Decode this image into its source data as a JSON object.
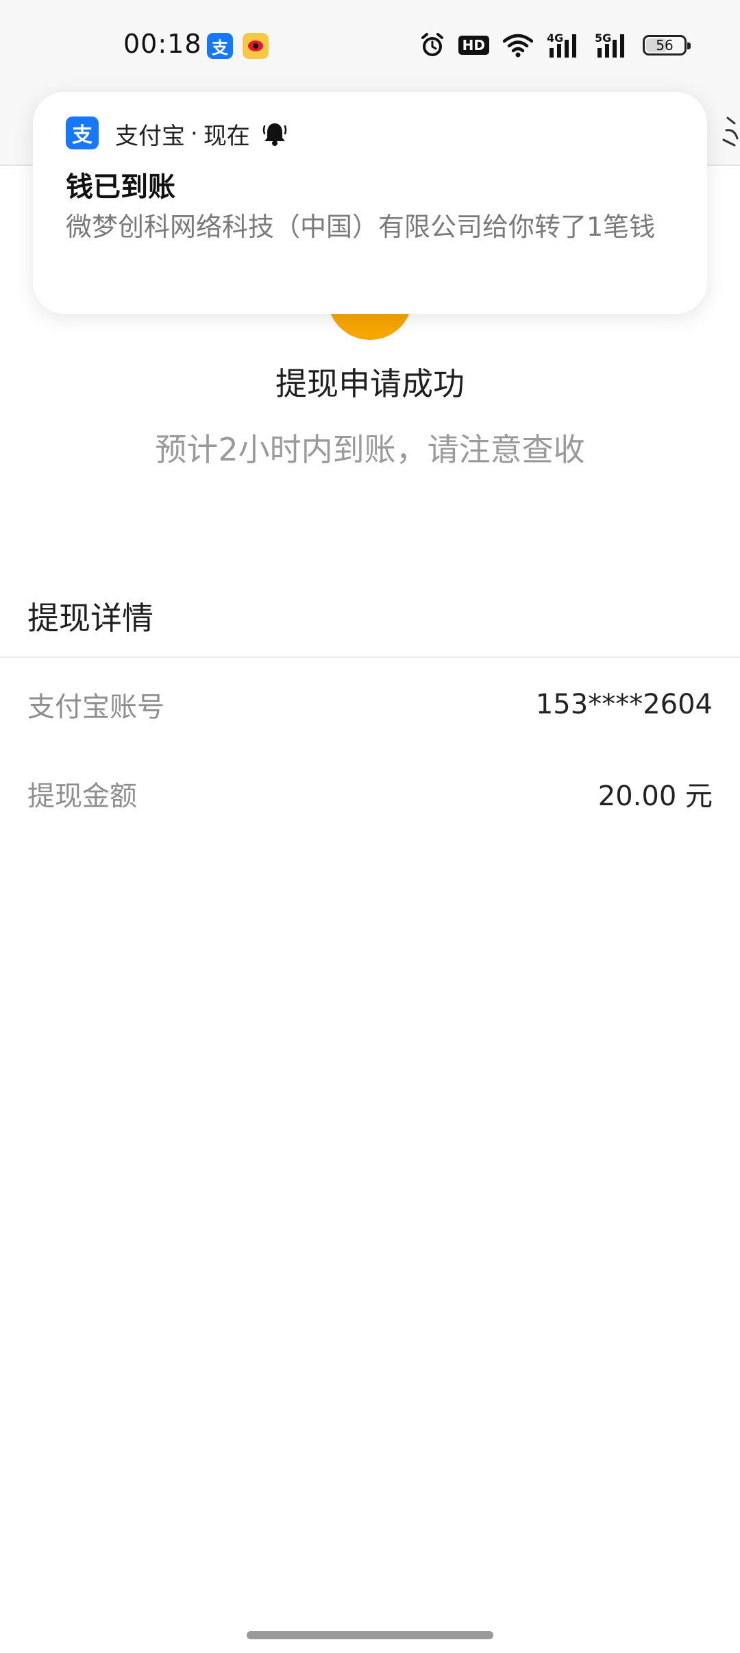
{
  "status_bar": {
    "time": "00:18",
    "battery": "56",
    "battery_level": 0.56,
    "network_4g": "4G",
    "network_5g": "5G",
    "hd_label": "HD"
  },
  "notification": {
    "app_icon_glyph": "支",
    "app_name": "支付宝",
    "separator": "·",
    "time": "现在",
    "title": "钱已到账",
    "body": "微梦创科网络科技（中国）有限公司给你转了1笔钱"
  },
  "success": {
    "title": "提现申请成功",
    "subtitle": "预计2小时内到账，请注意查收",
    "icon_color": "#f7a600"
  },
  "details": {
    "title": "提现详情",
    "rows": [
      {
        "label": "支付宝账号",
        "value": "153****2604"
      },
      {
        "label": "提现金额",
        "value": "20.00 元"
      }
    ]
  },
  "colors": {
    "alipay_blue": "#1677ff",
    "weibo_yellow": "#f7c844",
    "weibo_red": "#e6162d"
  },
  "icons": {
    "status_left": [
      "alipay-icon",
      "weibo-icon"
    ],
    "status_right": [
      "alarm-icon",
      "hd-icon",
      "wifi-icon",
      "signal-4g-icon",
      "signal-5g-icon",
      "battery-icon"
    ],
    "notification": [
      "alipay-icon",
      "bell-icon"
    ]
  }
}
